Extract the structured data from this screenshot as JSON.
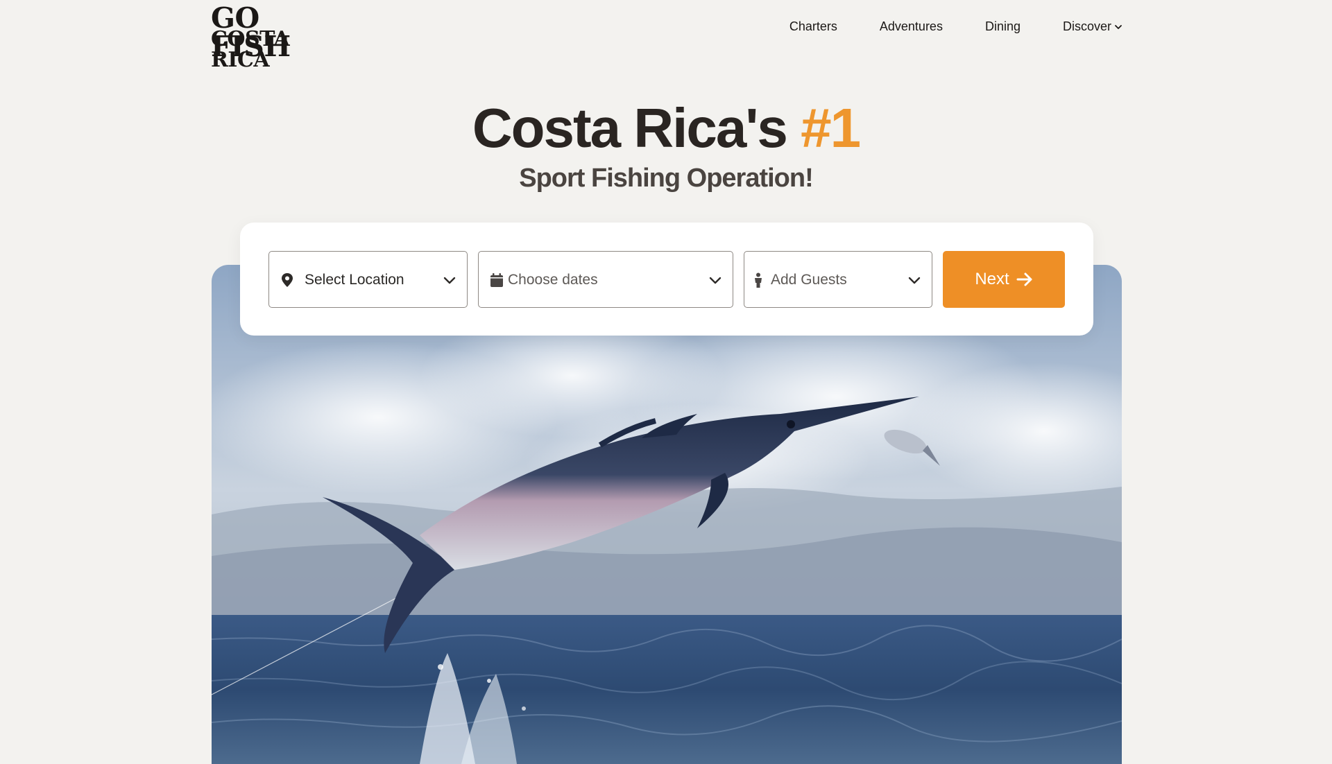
{
  "brand": {
    "logo_line1": "GO FISH",
    "logo_line2": "COSTA RICA"
  },
  "nav": {
    "items": [
      {
        "label": "Charters"
      },
      {
        "label": "Adventures"
      },
      {
        "label": "Dining"
      },
      {
        "label": "Discover",
        "has_dropdown": true
      }
    ]
  },
  "hero": {
    "headline_main": "Costa Rica's",
    "headline_accent": "#1",
    "subheadline": "Sport Fishing Operation!",
    "image_subject": "marlin leaping from ocean catching small fish"
  },
  "search": {
    "location": {
      "label": "Select Location",
      "icon": "map-pin-icon"
    },
    "dates": {
      "label": "Choose dates",
      "icon": "calendar-icon"
    },
    "guests": {
      "label": "Add Guests",
      "icon": "person-icon"
    },
    "next_label": "Next"
  },
  "colors": {
    "accent": "#ee8f26",
    "background": "#f3f2ef",
    "text_dark": "#2a2522"
  }
}
